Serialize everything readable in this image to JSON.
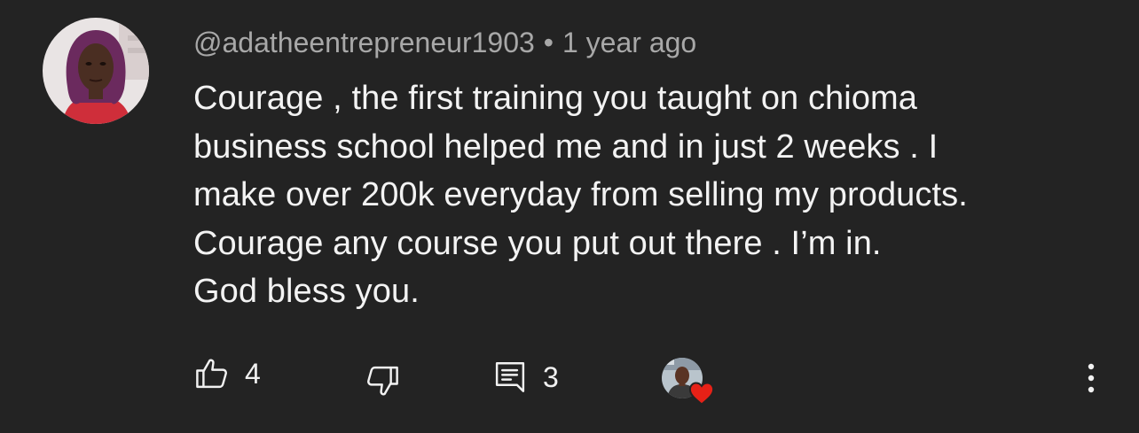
{
  "comment": {
    "author_handle": "@adatheentrepreneur1903",
    "separator": "•",
    "time_ago": "1 year ago",
    "lines": [
      "Courage , the first training you taught on chioma",
      "business school helped me and in just 2 weeks . I",
      "make over 200k everyday from selling my products.",
      "Courage any course you put out there . I’m in.",
      "God bless you."
    ]
  },
  "actions": {
    "like_count": "4",
    "reply_count": "3",
    "like_icon": "thumbs-up-icon",
    "dislike_icon": "thumbs-down-icon",
    "reply_icon": "reply-icon",
    "creator_heart_icon": "creator-heart-icon",
    "more_icon": "more-vertical-icon"
  },
  "colors": {
    "background": "#232323",
    "text": "#f3f3f3",
    "meta": "#a8a8a8",
    "heart": "#e62117"
  }
}
